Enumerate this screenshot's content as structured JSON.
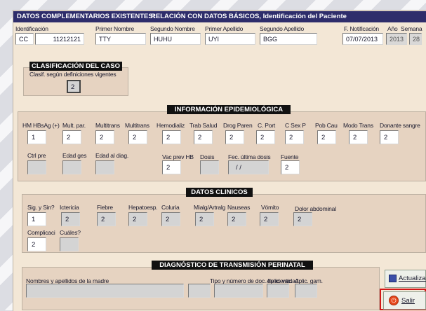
{
  "header": {
    "left": "DATOS COMPLEMENTARIOS EXISTENTES!",
    "right": "RELACIÓN CON DATOS BÁSICOS,  Identificación del Paciente"
  },
  "patient": {
    "identificacion_label": "Identificación",
    "tipo_doc": "CC",
    "num_doc": "11212121",
    "primer_nombre_label": "Primer Nombre",
    "primer_nombre": "TTY",
    "segundo_nombre_label": "Segundo Nombre",
    "segundo_nombre": "HUHU",
    "primer_apellido_label": "Primer Apellido",
    "primer_apellido": "UYI",
    "segundo_apellido_label": "Segundo Apellido",
    "segundo_apellido": "BGG",
    "fnotif_label": "F. Notificación",
    "fnotif": "07/07/2013",
    "anio_label": "Año",
    "anio": "2013",
    "semana_label": "Semana",
    "semana": "28"
  },
  "clasificacion": {
    "title": "CLASIFICACIÓN DEL CASO",
    "label": "Clasif. según definiciones vigentes",
    "value": "2"
  },
  "epidemio": {
    "title": "INFORMACIÓN EPIDEMIOLÓGICA",
    "row1": [
      {
        "label": "HM HBsAg (+)",
        "value": "1"
      },
      {
        "label": "Mult. par.",
        "value": "2"
      },
      {
        "label": "Multitrans",
        "value": "2"
      },
      {
        "label": "Multitrans",
        "value": "2"
      },
      {
        "label": "Hemodializ",
        "value": "2"
      },
      {
        "label": "Trab Salud",
        "value": "2"
      },
      {
        "label": "Drog Paren",
        "value": "2"
      },
      {
        "label": "C. Port",
        "value": "2"
      },
      {
        "label": "C Sex P",
        "value": "2"
      },
      {
        "label": "Pob Cau",
        "value": "2"
      },
      {
        "label": "Modo Trans",
        "value": "2"
      },
      {
        "label": "Donante sangre",
        "value": "2"
      }
    ],
    "ctrl_pre_label": "Ctrl pre",
    "edad_ges_label": "Edad ges",
    "edad_diag_label": "Edad al diag.",
    "vac_prev_label": "Vac prev HB",
    "vac_prev": "2",
    "dosis_label": "Dosis",
    "fec_dosis_label": "Fec. última dosis",
    "fec_dosis": "/ /",
    "fuente_label": "Fuente",
    "fuente": "2"
  },
  "clinicos": {
    "title": "DATOS CLINICOS",
    "items": [
      {
        "label": "Sig. y Sin?",
        "value": "1"
      },
      {
        "label": "Ictericia",
        "value": "2"
      },
      {
        "label": "Fiebre",
        "value": "2"
      },
      {
        "label": "Hepatoesp.",
        "value": "2"
      },
      {
        "label": "Coluria",
        "value": "2"
      },
      {
        "label": "Mialg/Artralg",
        "value": "2"
      },
      {
        "label": "Nauseas",
        "value": "2"
      },
      {
        "label": "Vómito",
        "value": "2"
      },
      {
        "label": "Dolor abdominal",
        "value": "2"
      }
    ],
    "complicaci_label": "Complicaci",
    "complicaci": "2",
    "cuales_label": "Cuáles?"
  },
  "perinatal": {
    "title": "DIAGNÓSTICO DE TRANSMISIÓN PERINATAL",
    "madre_label": "Nombres y apellidos de la madre",
    "tipo_doc_label": "Tipo y número de doc. de identidad",
    "aplic_vac_label": "Aplic. vac.",
    "aplic_gam_label": "Aplic. gam."
  },
  "buttons": {
    "actualizar": "Actualizar",
    "salir": "Salir"
  }
}
